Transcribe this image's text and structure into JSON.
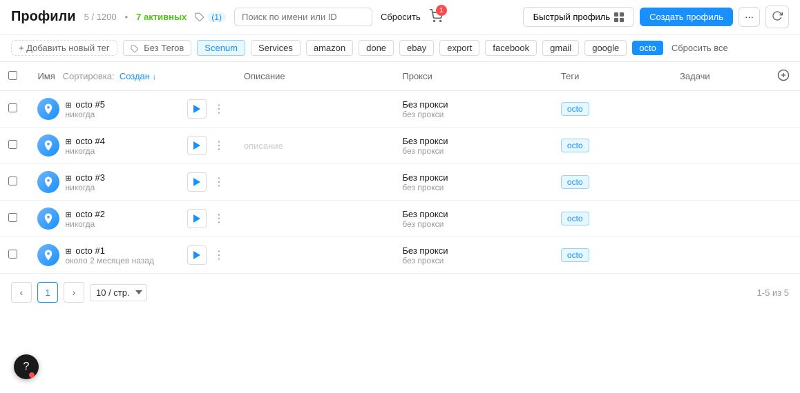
{
  "header": {
    "title": "Профили",
    "count": "5 / 1200",
    "active_count": "7 активных",
    "tags_label": "(1)",
    "search_placeholder": "Поиск по имени или ID",
    "reset_label": "Сбросить",
    "cart_count": "1",
    "quick_profile_label": "Быстрый профиль",
    "create_label": "Создать профиль",
    "more_label": "···"
  },
  "tags_bar": {
    "add_label": "+ Добавить новый тег",
    "tags": [
      {
        "id": "no-tags",
        "label": "Без Тегов",
        "style": "no-tags"
      },
      {
        "id": "scenum",
        "label": "Scenum",
        "style": "scenum"
      },
      {
        "id": "services",
        "label": "Services",
        "style": "services"
      },
      {
        "id": "amazon",
        "label": "amazon",
        "style": "amazon"
      },
      {
        "id": "done",
        "label": "done",
        "style": "done"
      },
      {
        "id": "ebay",
        "label": "ebay",
        "style": "ebay"
      },
      {
        "id": "export",
        "label": "export",
        "style": "export"
      },
      {
        "id": "facebook",
        "label": "facebook",
        "style": "facebook"
      },
      {
        "id": "gmail",
        "label": "gmail",
        "style": "gmail"
      },
      {
        "id": "google",
        "label": "google",
        "style": "google"
      },
      {
        "id": "octo",
        "label": "octo",
        "style": "octo"
      }
    ],
    "reset_all_label": "Сбросить все"
  },
  "table": {
    "columns": {
      "name": "Имя",
      "sort_label": "Сортировка:",
      "sort_field": "Создан",
      "description": "Описание",
      "proxy": "Прокси",
      "tags": "Теги",
      "tasks": "Задачи"
    },
    "rows": [
      {
        "name": "octo #5",
        "date": "никогда",
        "description": "",
        "proxy_main": "Без прокси",
        "proxy_sub": "без прокси",
        "tag": "octo"
      },
      {
        "name": "octo #4",
        "date": "никогда",
        "description": "описание",
        "proxy_main": "Без прокси",
        "proxy_sub": "без прокси",
        "tag": "octo"
      },
      {
        "name": "octo #3",
        "date": "никогда",
        "description": "",
        "proxy_main": "Без прокси",
        "proxy_sub": "без прокси",
        "tag": "octo"
      },
      {
        "name": "octo #2",
        "date": "никогда",
        "description": "",
        "proxy_main": "Без прокси",
        "proxy_sub": "без прокси",
        "tag": "octo"
      },
      {
        "name": "octo #1",
        "date": "около 2 месяцев назад",
        "description": "",
        "proxy_main": "Без прокси",
        "proxy_sub": "без прокси",
        "tag": "octo"
      }
    ]
  },
  "pagination": {
    "current_page": "1",
    "per_page": "10 / стр.",
    "total_label": "1-5 из 5"
  },
  "help": {
    "label": "?"
  }
}
